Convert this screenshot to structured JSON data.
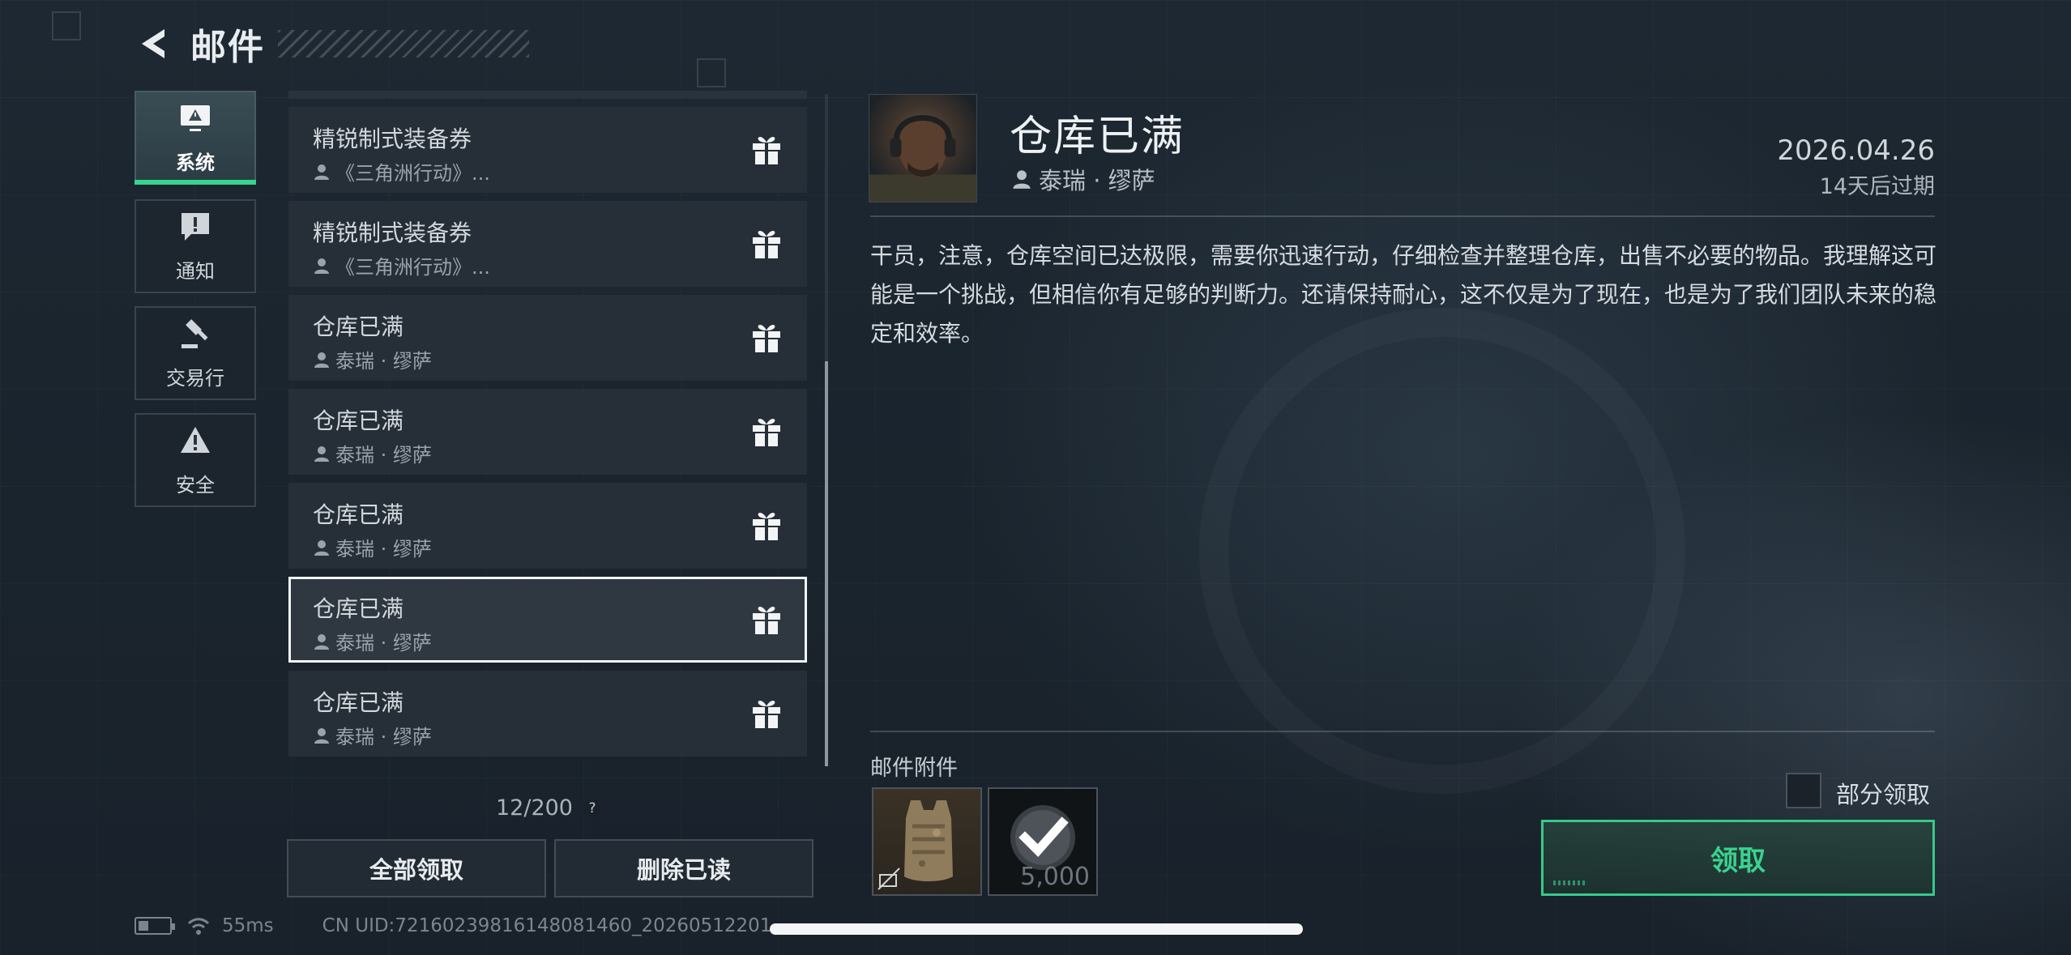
{
  "header": {
    "title": "邮件"
  },
  "categories": [
    {
      "label": "系统",
      "icon": "monitor-alert-icon",
      "active": true
    },
    {
      "label": "通知",
      "icon": "message-alert-icon",
      "active": false
    },
    {
      "label": "交易行",
      "icon": "gavel-icon",
      "active": false
    },
    {
      "label": "安全",
      "icon": "warning-triangle-icon",
      "active": false
    }
  ],
  "mails": [
    {
      "title": "精锐制式装备券",
      "sender": "《三角洲行动》..."
    },
    {
      "title": "精锐制式装备券",
      "sender": "《三角洲行动》..."
    },
    {
      "title": "仓库已满",
      "sender": "泰瑞 · 缪萨"
    },
    {
      "title": "仓库已满",
      "sender": "泰瑞 · 缪萨"
    },
    {
      "title": "仓库已满",
      "sender": "泰瑞 · 缪萨"
    },
    {
      "title": "仓库已满",
      "sender": "泰瑞 · 缪萨",
      "selected": true
    },
    {
      "title": "仓库已满",
      "sender": "泰瑞 · 缪萨"
    }
  ],
  "mail_count": "12/200",
  "help_symbol": "?",
  "actions": {
    "claim_all": "全部领取",
    "delete_read": "删除已读"
  },
  "detail": {
    "title": "仓库已满",
    "sender": "泰瑞 · 缪萨",
    "date": "2026.04.26",
    "expire": "14天后过期",
    "body": "干员，注意，仓库空间已达极限，需要你迅速行动，仔细检查并整理仓库，出售不必要的物品。我理解这可能是一个挑战，但相信你有足够的判断力。还请保持耐心，这不仅是为了现在，也是为了我们团队未来的稳定和效率。",
    "attachments_label": "邮件附件",
    "attachments": [
      {
        "name": "armor-vest",
        "qty": ""
      },
      {
        "name": "coin-check",
        "qty": "5,000"
      }
    ],
    "partial_claim": "部分领取",
    "claim": "领取"
  },
  "status": {
    "ping": "55ms",
    "uid": "CN UID:72160239816148081460_20260512201"
  },
  "colors": {
    "accent": "#35d48f",
    "panel": "#262f38",
    "background": "#1b252e"
  }
}
